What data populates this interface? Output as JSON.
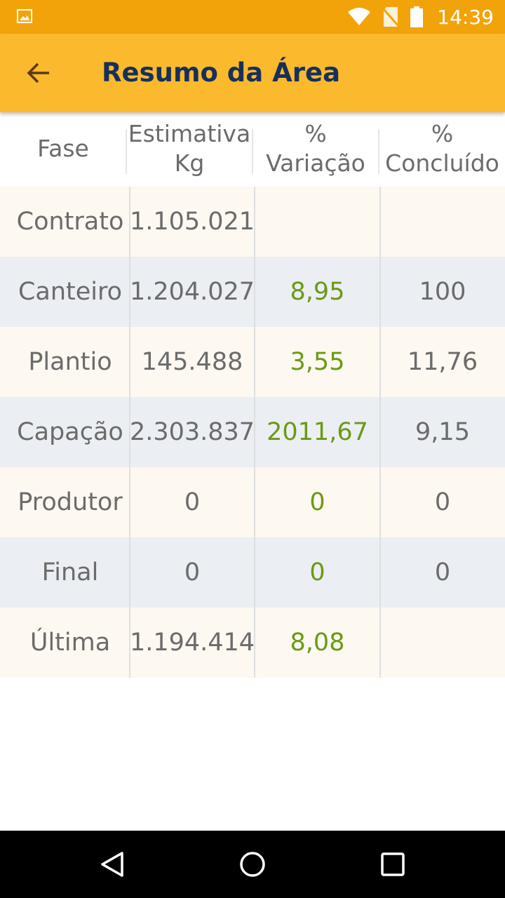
{
  "status_bar": {
    "time": "14:39",
    "icons": [
      "gallery-icon",
      "wifi-icon",
      "no-sim-icon",
      "battery-icon"
    ]
  },
  "app_bar": {
    "title": "Resumo da Área",
    "back_icon": "arrow-back-icon"
  },
  "table": {
    "headers": [
      {
        "line1": "Fase",
        "line2": ""
      },
      {
        "line1": "Estimativa",
        "line2": "Kg"
      },
      {
        "line1": "%",
        "line2": "Variação"
      },
      {
        "line1": "%",
        "line2": "Concluído"
      }
    ],
    "rows": [
      {
        "fase": "Contrato",
        "estimativa": "1.105.021",
        "variacao": "",
        "concluido": ""
      },
      {
        "fase": "Canteiro",
        "estimativa": "1.204.027",
        "variacao": "8,95",
        "concluido": "100"
      },
      {
        "fase": "Plantio",
        "estimativa": "145.488",
        "variacao": "3,55",
        "concluido": "11,76"
      },
      {
        "fase": "Capação",
        "estimativa": "2.303.837",
        "variacao": "2011,67",
        "concluido": "9,15"
      },
      {
        "fase": "Produtor",
        "estimativa": "0",
        "variacao": "0",
        "concluido": "0"
      },
      {
        "fase": "Final",
        "estimativa": "0",
        "variacao": "0",
        "concluido": "0"
      },
      {
        "fase": "Última",
        "estimativa": "1.194.414",
        "variacao": "8,08",
        "concluido": ""
      }
    ]
  },
  "nav_bar": {
    "icons": [
      "back-triangle-icon",
      "home-circle-icon",
      "recents-square-icon"
    ]
  },
  "colors": {
    "status_bar": "#f2a30a",
    "app_bar": "#fbb92d",
    "title_text": "#16305a",
    "variation_text": "#6a9a14",
    "row_odd": "#fdf8f0",
    "row_even": "#ebeef3"
  }
}
